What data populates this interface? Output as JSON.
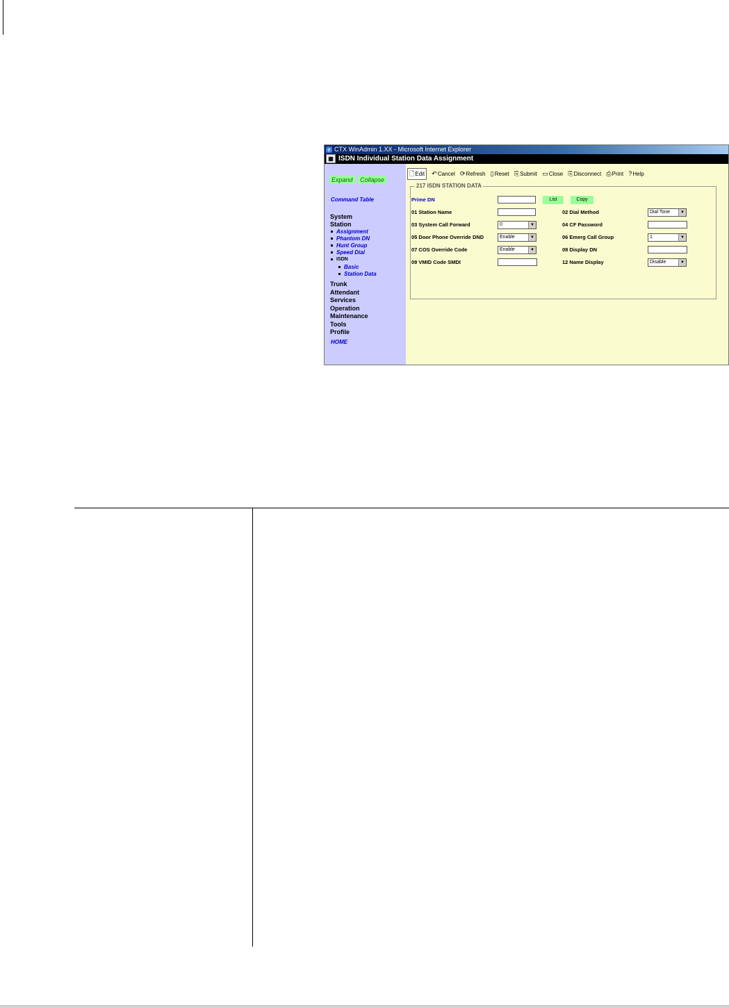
{
  "window": {
    "browser_title": "CTX WinAdmin 1.XX - Microsoft Internet Explorer",
    "app_title": "ISDN Individual Station Data Assignment"
  },
  "sidebar": {
    "expand": "Expand",
    "collapse": "Collapse",
    "command_table": "Command Table",
    "system": "System",
    "station": "Station",
    "station_items": [
      "Assignment",
      "Phantom DN",
      "Hunt Group",
      "Speed Dial"
    ],
    "isdn": "ISDN",
    "isdn_items": [
      "Basic",
      "Station Data"
    ],
    "other_items": [
      "Trunk",
      "Attendant",
      "Services",
      "Operation",
      "Maintenance",
      "Tools",
      "Profile"
    ],
    "home": "HOME"
  },
  "toolbar": {
    "edit": "Edit",
    "cancel": "Cancel",
    "refresh": "Refresh",
    "reset": "Reset",
    "submit": "Submit",
    "close": "Close",
    "disconnect": "Disconnect",
    "print": "Print",
    "help": "Help"
  },
  "form": {
    "legend": "217 ISDN STATION DATA",
    "prime_dn_label": "Prime DN",
    "list_button": "List",
    "copy_button": "Copy",
    "station_name_label": "01 Station Name",
    "dial_method_label": "02 Dial Method",
    "dial_method_value": "Dial Tone",
    "system_call_forward_label": "03 System Call Forward",
    "system_call_forward_value": "0",
    "cf_password_label": "04 CF Password",
    "door_phone_label": "05 Door Phone Override DND",
    "door_phone_value": "Enable",
    "emerg_call_group_label": "06 Emerg Call Group",
    "emerg_call_group_value": "1",
    "cos_override_label": "07 COS Override Code",
    "cos_override_value": "Enable",
    "display_dn_label": "08 Display DN",
    "vmid_label": "09 VMID Code SMDI",
    "name_display_label": "12 Name Display",
    "name_display_value": "Disable"
  }
}
